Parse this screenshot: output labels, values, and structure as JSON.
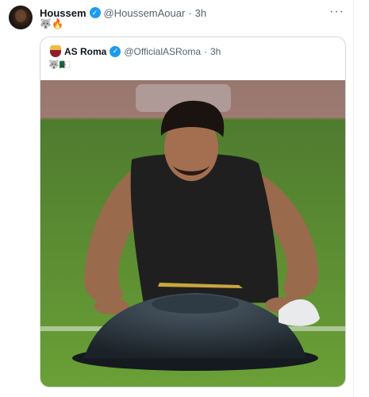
{
  "tweet": {
    "author_name": "Houssem",
    "author_handle": "@HoussemAouar",
    "separator": "·",
    "time": "3h",
    "text": "🐺🔥",
    "more_label": "···"
  },
  "quoted": {
    "author_name": "AS Roma",
    "author_handle": "@OfficialASRoma",
    "separator": "·",
    "time": "3h",
    "text": "🐺🇩🇿",
    "photo_alt": "Player doing push-ups on a balance trainer on a training pitch"
  },
  "colors": {
    "verified": "#1d9bf0",
    "muted_text": "#536471",
    "border": "#cfd9de"
  }
}
